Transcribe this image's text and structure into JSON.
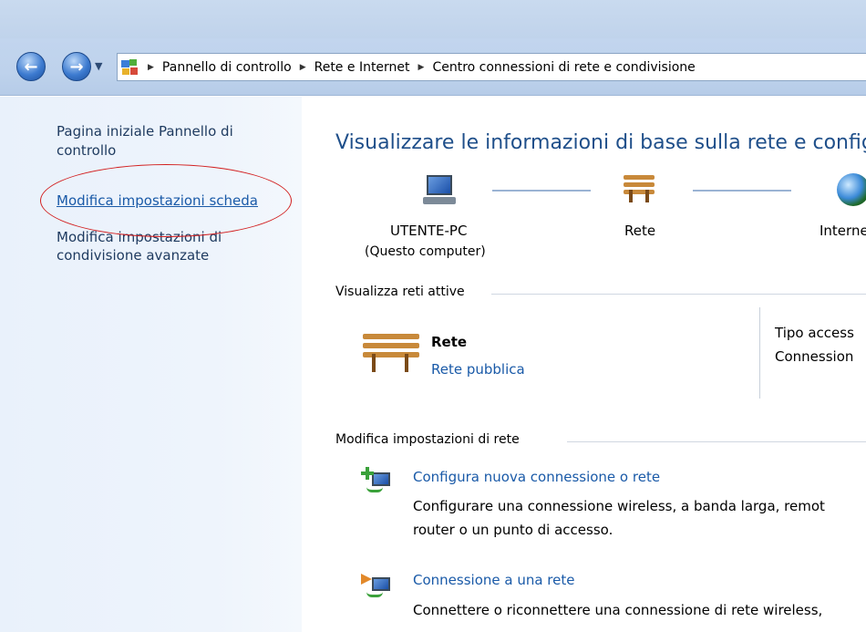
{
  "address_bar": {
    "breadcrumbs": [
      "Pannello di controllo",
      "Rete e Internet",
      "Centro connessioni di rete e condivisione"
    ]
  },
  "left_pane": {
    "home_link": "Pagina iniziale Pannello di controllo",
    "links": [
      "Modifica impostazioni scheda",
      "Modifica impostazioni di condivisione avanzate"
    ]
  },
  "main": {
    "title": "Visualizzare le informazioni di base sulla rete e configu",
    "network_map": {
      "computer_label": "UTENTE-PC",
      "computer_sublabel": "(Questo computer)",
      "network_label": "Rete",
      "internet_label": "Interne"
    },
    "active_networks": {
      "heading": "Visualizza reti attive",
      "network_name": "Rete",
      "network_type": "Rete pubblica",
      "access_type_label": "Tipo access",
      "connections_label": "Connession"
    },
    "change_settings": {
      "heading": "Modifica impostazioni di rete",
      "tasks": [
        {
          "title": "Configura nuova connessione o rete",
          "desc_line1": "Configurare una connessione wireless, a banda larga, remot",
          "desc_line2": "router o un punto di accesso."
        },
        {
          "title": "Connessione a una rete",
          "desc_line1": "Connettere o riconnettere una connessione di rete wireless,"
        }
      ]
    }
  },
  "colors": {
    "link": "#1a5aa8",
    "title": "#1f4f8a",
    "annotation_ellipse": "#d21f1f"
  }
}
